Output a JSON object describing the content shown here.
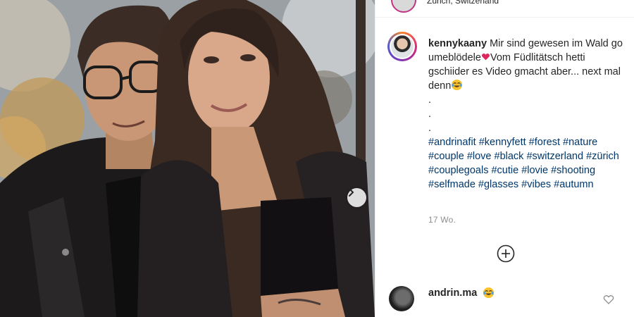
{
  "post": {
    "location_fragment": "Zürich, Switzerland",
    "caption_user": "kennykaany",
    "caption_line1": "Mir sind gewesen im Wald go umeblödele",
    "caption_line1b": "Vom Füdlitätsch hetti gschiider es Video gmacht aber... next mal denn",
    "dots": [
      ".",
      ".",
      "."
    ],
    "hashtags": "#andrinafit #kennyfett #forest #nature #couple #love #black #switzerland #zürich #couplegoals #cutie #lovie #shooting #selfmade #glasses #vibes #autumn",
    "timestamp": "17 Wo."
  },
  "comment": {
    "user": "andrin.ma"
  },
  "icons": {
    "next": "chevron-right-icon",
    "load_more": "plus-circle-icon",
    "like": "heart-outline-icon",
    "heart_emoji": "red-heart-emoji",
    "laugh_emoji": "tears-of-joy-emoji"
  },
  "colors": {
    "hashtag": "#00376b",
    "timestamp": "#8e8e8e",
    "text": "#262626"
  }
}
